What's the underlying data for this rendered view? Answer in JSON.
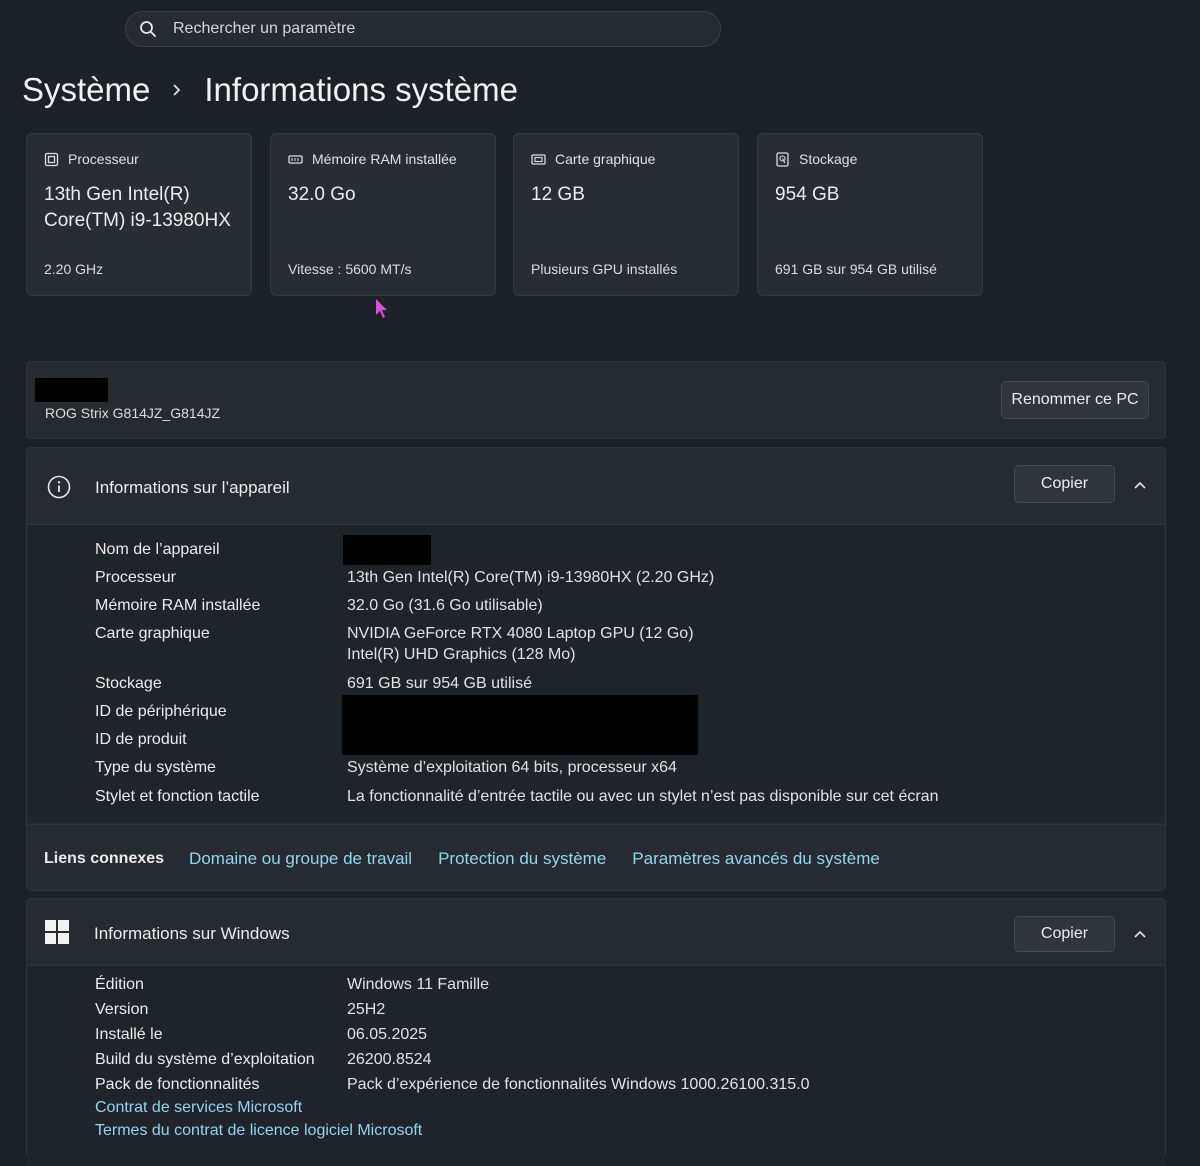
{
  "search": {
    "placeholder": "Rechercher un paramètre"
  },
  "breadcrumb": {
    "parent": "Système",
    "current": "Informations système"
  },
  "cards": [
    {
      "title": "Processeur",
      "value": "13th Gen Intel(R) Core(TM) i9-13980HX",
      "sub": "2.20 GHz",
      "icon": "processor-icon"
    },
    {
      "title": "Mémoire RAM installée",
      "value": "32.0 Go",
      "sub": "Vitesse : 5600 MT/s",
      "icon": "memory-icon"
    },
    {
      "title": "Carte graphique",
      "value": "12 GB",
      "sub": "Plusieurs GPU installés",
      "icon": "gpu-icon"
    },
    {
      "title": "Stockage",
      "value": "954 GB",
      "sub": "691 GB sur 954 GB utilisé",
      "icon": "storage-icon"
    }
  ],
  "pc": {
    "model": "ROG Strix G814JZ_G814JZ",
    "rename_label": "Renommer ce PC"
  },
  "device": {
    "title": "Informations sur l’appareil",
    "copy_label": "Copier",
    "rows": [
      {
        "label": "Nom de l’appareil",
        "value": ""
      },
      {
        "label": "Processeur",
        "value": "13th Gen Intel(R) Core(TM) i9-13980HX (2.20 GHz)"
      },
      {
        "label": "Mémoire RAM installée",
        "value": "32.0 Go (31.6 Go utilisable)"
      },
      {
        "label": "Carte graphique",
        "value": "NVIDIA GeForce RTX 4080 Laptop GPU (12 Go)",
        "value2": "Intel(R) UHD Graphics (128 Mo)"
      },
      {
        "label": "Stockage",
        "value": "691 GB sur 954 GB utilisé"
      },
      {
        "label": "ID de périphérique",
        "value": ""
      },
      {
        "label": "ID de produit",
        "value": ""
      },
      {
        "label": "Type du système",
        "value": "Système d’exploitation 64 bits, processeur x64"
      },
      {
        "label": "Stylet et fonction tactile",
        "value": "La fonctionnalité d’entrée tactile ou avec un stylet n’est pas disponible sur cet écran"
      }
    ]
  },
  "related": {
    "label": "Liens connexes",
    "links": [
      "Domaine ou groupe de travail",
      "Protection du système",
      "Paramètres avancés du système"
    ]
  },
  "windows": {
    "title": "Informations sur Windows",
    "copy_label": "Copier",
    "rows": [
      {
        "label": "Édition",
        "value": "Windows 11 Famille"
      },
      {
        "label": "Version",
        "value": "25H2"
      },
      {
        "label": "Installé le",
        "value": "06.05.2025"
      },
      {
        "label": "Build du système d’exploitation",
        "value": "26200.8524"
      },
      {
        "label": "Pack de fonctionnalités",
        "value": "Pack d’expérience de fonctionnalités Windows 1000.26100.315.0"
      }
    ],
    "links": [
      "Contrat de services Microsoft",
      "Termes du contrat de licence logiciel Microsoft"
    ]
  },
  "colors": {
    "accent_link": "#8fd8ec",
    "cursor": "#d94fd6",
    "background": "#1c2027"
  }
}
